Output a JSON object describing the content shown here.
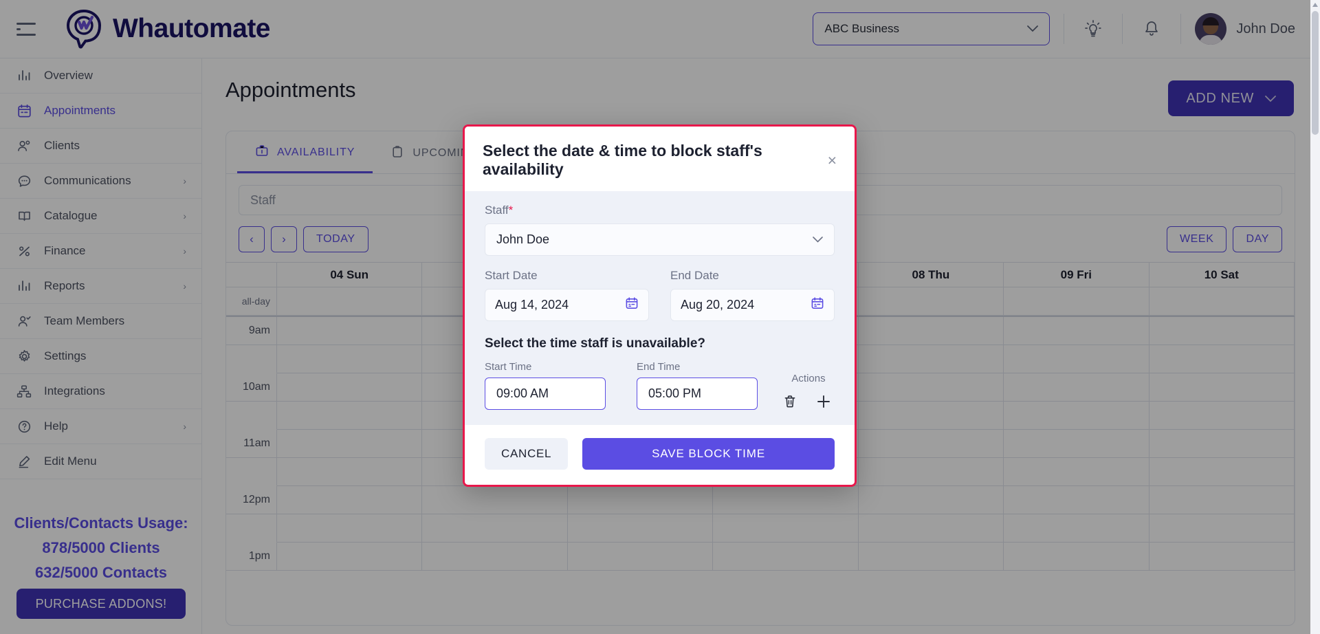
{
  "brand": {
    "name": "Whautomate"
  },
  "topbar": {
    "business_select": "ABC Business",
    "user_name": "John Doe"
  },
  "sidebar": {
    "items": [
      {
        "label": "Overview",
        "icon": "bar-chart-icon",
        "has_caret": false,
        "active": false
      },
      {
        "label": "Appointments",
        "icon": "calendar-icon",
        "has_caret": false,
        "active": true
      },
      {
        "label": "Clients",
        "icon": "users-icon",
        "has_caret": false,
        "active": false
      },
      {
        "label": "Communications",
        "icon": "chat-bubble-icon",
        "has_caret": true,
        "active": false
      },
      {
        "label": "Catalogue",
        "icon": "book-icon",
        "has_caret": true,
        "active": false
      },
      {
        "label": "Finance",
        "icon": "percent-icon",
        "has_caret": true,
        "active": false
      },
      {
        "label": "Reports",
        "icon": "bar-chart-icon",
        "has_caret": true,
        "active": false
      },
      {
        "label": "Team Members",
        "icon": "user-check-icon",
        "has_caret": false,
        "active": false
      },
      {
        "label": "Settings",
        "icon": "gear-icon",
        "has_caret": false,
        "active": false
      },
      {
        "label": "Integrations",
        "icon": "sitemap-icon",
        "has_caret": false,
        "active": false
      },
      {
        "label": "Help",
        "icon": "question-circle-icon",
        "has_caret": true,
        "active": false
      },
      {
        "label": "Edit Menu",
        "icon": "pencil-icon",
        "has_caret": false,
        "active": false
      }
    ],
    "usage": {
      "title": "Clients/Contacts Usage:",
      "clients": "878/5000 Clients",
      "contacts": "632/5000 Contacts",
      "addons_button": "PURCHASE ADDONS!"
    }
  },
  "main": {
    "page_title": "Appointments",
    "add_new_button": "ADD NEW",
    "tabs": [
      {
        "label": "AVAILABILITY",
        "icon": "briefcase-icon",
        "active": true
      },
      {
        "label": "UPCOMING",
        "icon": "clipboard-icon",
        "active": false
      }
    ],
    "staff_filter_placeholder": "Staff",
    "toolbar": {
      "prev": "‹",
      "next": "›",
      "today": "TODAY",
      "week": "WEEK",
      "day": "DAY"
    },
    "calendar": {
      "day_headers": [
        "04 Sun",
        "",
        "",
        "",
        "08 Thu",
        "09 Fri",
        "10 Sat"
      ],
      "all_day_label": "all-day",
      "time_labels": [
        "9am",
        "",
        "10am",
        "",
        "11am",
        "",
        "12pm",
        "",
        "1pm"
      ]
    }
  },
  "modal": {
    "title": "Select the date & time to block staff's availability",
    "close_icon": "×",
    "staff_label": "Staff",
    "staff_required": "*",
    "staff_value": "John Doe",
    "start_date_label": "Start Date",
    "start_date_value": "Aug 14, 2024",
    "end_date_label": "End Date",
    "end_date_value": "Aug 20, 2024",
    "time_question": "Select the time staff is unavailable?",
    "start_time_label": "Start Time",
    "start_time_value": "09:00 AM",
    "end_time_label": "End Time",
    "end_time_value": "05:00 PM",
    "actions_label": "Actions",
    "cancel_button": "CANCEL",
    "save_button": "SAVE BLOCK TIME"
  },
  "colors": {
    "accent_purple": "#5b4de3",
    "deep_purple": "#3f32b5",
    "modal_border": "#e8174b",
    "modal_body": "#eef1f8",
    "brand_navy": "#1b1464"
  }
}
